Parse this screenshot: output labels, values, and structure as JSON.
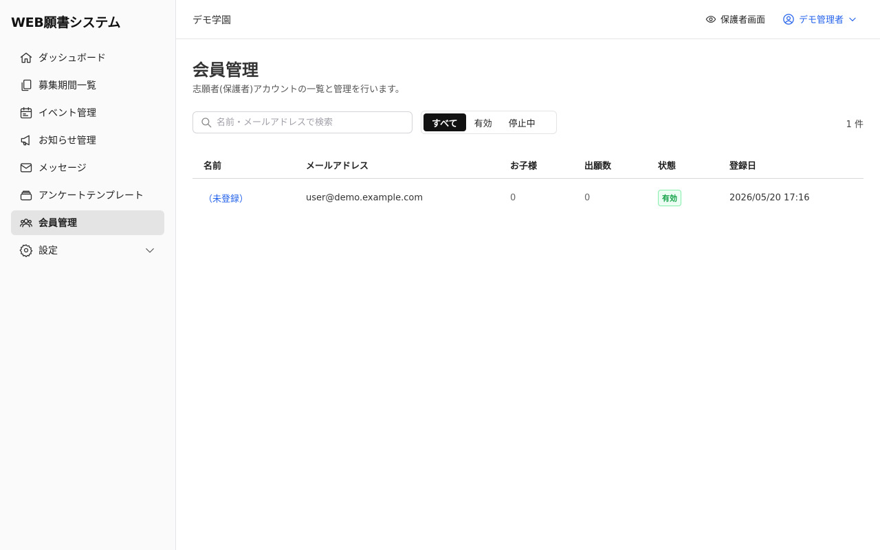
{
  "app": {
    "title": "WEB願書システム"
  },
  "sidebar": {
    "items": [
      {
        "label": "ダッシュボード",
        "icon": "home-icon"
      },
      {
        "label": "募集期間一覧",
        "icon": "documents-icon"
      },
      {
        "label": "イベント管理",
        "icon": "calendar-icon"
      },
      {
        "label": "お知らせ管理",
        "icon": "megaphone-icon"
      },
      {
        "label": "メッセージ",
        "icon": "mail-icon"
      },
      {
        "label": "アンケートテンプレート",
        "icon": "stack-icon"
      },
      {
        "label": "会員管理",
        "icon": "users-icon",
        "active": true
      },
      {
        "label": "設定",
        "icon": "gear-icon",
        "expandable": true
      }
    ]
  },
  "header": {
    "school": "デモ学園",
    "guardian_view": "保護者画面",
    "user": "デモ管理者"
  },
  "main": {
    "title": "会員管理",
    "description": "志願者(保護者)アカウントの一覧と管理を行います。",
    "search": {
      "placeholder": "名前・メールアドレスで検索",
      "value": ""
    },
    "filters": [
      "すべて",
      "有効",
      "停止中"
    ],
    "active_filter": "すべて",
    "count": "1 件",
    "table": {
      "columns": [
        "名前",
        "メールアドレス",
        "お子様",
        "出願数",
        "状態",
        "登録日"
      ],
      "rows": [
        {
          "name": "（未登録）",
          "email": "user@demo.example.com",
          "children": "0",
          "applications": "0",
          "status": "有効",
          "registered": "2026/05/20 17:16"
        }
      ]
    }
  },
  "colors": {
    "accent": "#2563eb",
    "active_bg": "#e4e4e4",
    "success": "#16a34a"
  }
}
